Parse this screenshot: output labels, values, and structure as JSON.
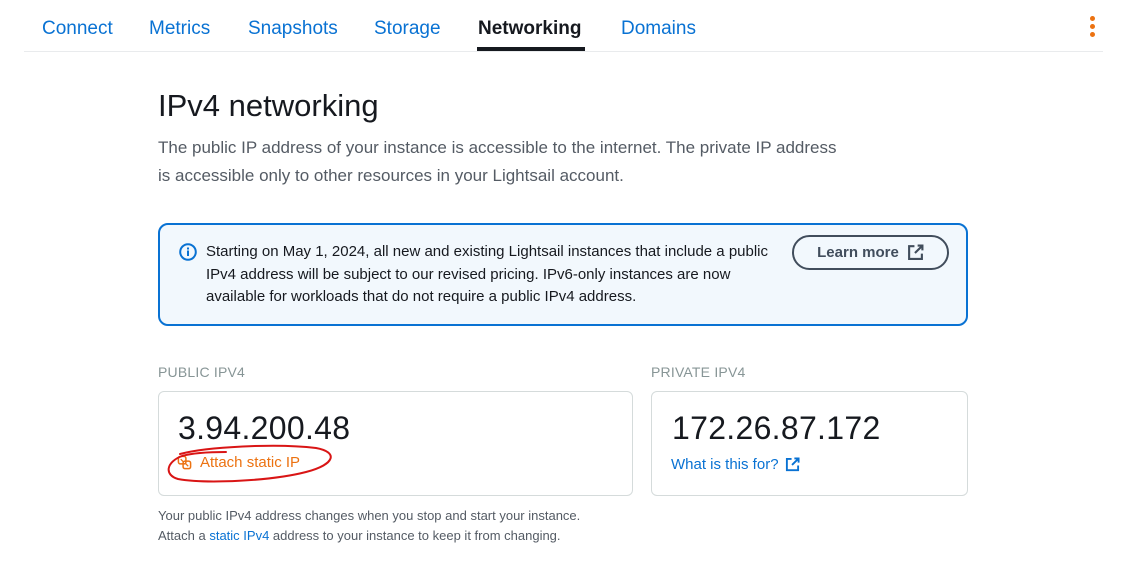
{
  "tabs": [
    {
      "label": "Connect",
      "active": false
    },
    {
      "label": "Metrics",
      "active": false
    },
    {
      "label": "Snapshots",
      "active": false
    },
    {
      "label": "Storage",
      "active": false
    },
    {
      "label": "Networking",
      "active": true
    },
    {
      "label": "Domains",
      "active": false
    }
  ],
  "header": {
    "menu_icon": "kebab-menu-icon",
    "menu_color": "#ec7211"
  },
  "page": {
    "title": "IPv4 networking",
    "description": "The public IP address of your instance is accessible to the internet. The private IP address is accessible only to other resources in your Lightsail account."
  },
  "alert": {
    "icon": "info-icon",
    "text": "Starting on May 1, 2024, all new and existing Lightsail instances that include a public IPv4 address will be subject to our revised pricing. IPv6-only instances are now available for workloads that do not require a public IPv4 address.",
    "button_label": "Learn more",
    "button_icon": "external-link-icon",
    "border_color": "#0972d3"
  },
  "public_ipv4": {
    "label": "PUBLIC IPV4",
    "address": "3.94.200.48",
    "action_label": "Attach static IP",
    "action_icon": "static-ip-icon",
    "action_color": "#ec7211",
    "annotation_color": "#d91515"
  },
  "private_ipv4": {
    "label": "PRIVATE IPV4",
    "address": "172.26.87.172",
    "link_label": "What is this for?",
    "link_icon": "external-link-icon"
  },
  "footnote": {
    "line1": "Your public IPv4 address changes when you stop and start your instance.",
    "line2_prefix": "Attach a",
    "line2_link": "static IPv4",
    "line2_suffix": "address to your instance to keep it from changing."
  }
}
